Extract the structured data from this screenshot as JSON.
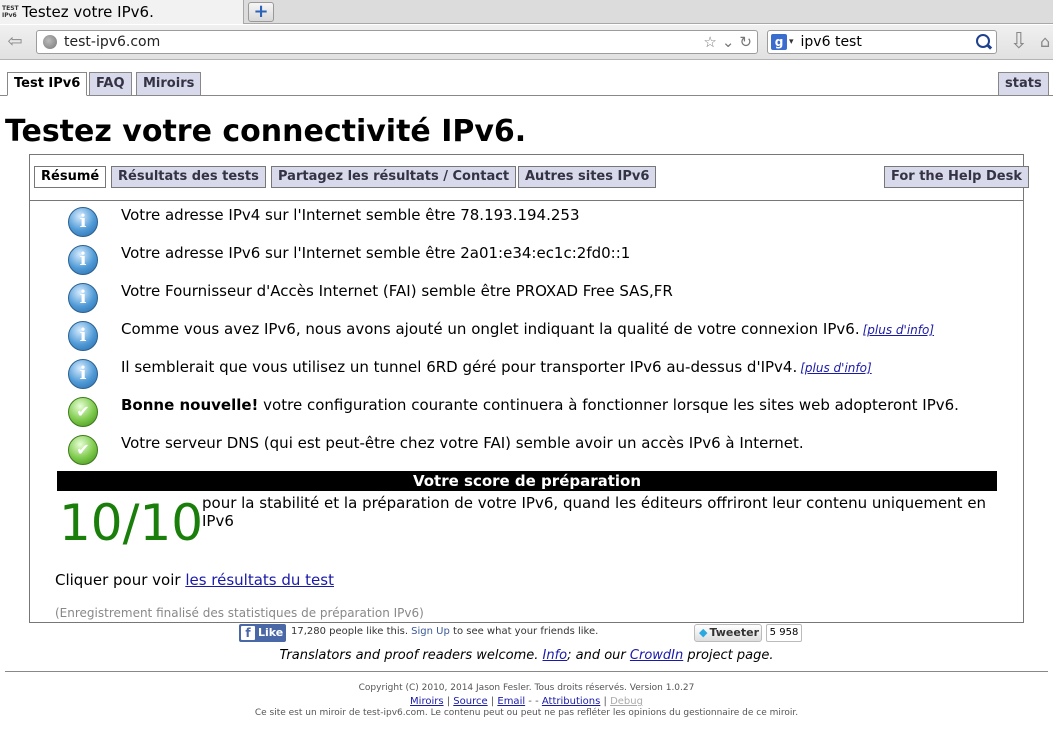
{
  "browser": {
    "tab_title": "Testez votre IPv6.",
    "favicon_text": "TEST IPv6",
    "new_tab": "+",
    "url": "test-ipv6.com",
    "search_query": "ipv6 test",
    "search_engine": "g"
  },
  "site_tabs": [
    "Test IPv6",
    "FAQ",
    "Miroirs"
  ],
  "stats_tab": "stats",
  "page_title": "Testez votre connectivité IPv6.",
  "panel_tabs": [
    "Résumé",
    "Résultats des tests",
    "Partagez les résultats / Contact",
    "Autres sites IPv6"
  ],
  "help_desk_tab": "For the Help Desk",
  "results": [
    {
      "icon": "info",
      "text": "Votre adresse IPv4 sur l'Internet semble être 78.193.194.253"
    },
    {
      "icon": "info",
      "text": "Votre adresse IPv6 sur l'Internet semble être 2a01:e34:ec1c:2fd0::1"
    },
    {
      "icon": "info",
      "text": "Votre Fournisseur d'Accès Internet (FAI) semble être PROXAD Free SAS,FR"
    },
    {
      "icon": "info",
      "text": "Comme vous avez IPv6, nous avons ajouté un onglet indiquant la qualité de votre connexion IPv6.",
      "more": "[plus d'info]"
    },
    {
      "icon": "info",
      "text": "Il semblerait que vous utilisez un tunnel 6RD géré pour transporter IPv6 au-dessus d'IPv4.",
      "more": "[plus d'info]"
    },
    {
      "icon": "ok",
      "bold": "Bonne nouvelle!",
      "text": " votre configuration courante continuera à fonctionner lorsque les sites web adopteront IPv6."
    },
    {
      "icon": "ok",
      "text": "Votre serveur DNS (qui est peut-être chez votre FAI) semble avoir un accès IPv6 à Internet."
    }
  ],
  "score": {
    "header": "Votre score de préparation",
    "value": "10/10",
    "description": "pour la stabilité et la préparation de votre IPv6, quand les éditeurs offriront leur contenu uniquement en IPv6"
  },
  "click_prefix": "Cliquer pour voir ",
  "click_link": "les résultats du test",
  "finalized": "(Enregistrement finalisé des statistiques de préparation IPv6)",
  "social": {
    "like": "Like",
    "like_text_pre": "17,280 people like this. ",
    "signup": "Sign Up",
    "like_text_post": " to see what your friends like.",
    "tweet": "Tweeter",
    "tweet_count": "5 958"
  },
  "translators": {
    "pre": "Translators and proof readers welcome. ",
    "info": "Info",
    "mid": "; and our ",
    "crowdin": "CrowdIn",
    "post": " project page."
  },
  "copyright": "Copyright (C) 2010, 2014 Jason Fesler. Tous droits réservés. Version 1.0.27",
  "footer_links": {
    "miroirs": "Miroirs",
    "sep1": " | ",
    "source": "Source",
    "sep2": " | ",
    "email": "Email",
    "sep3": " -  - ",
    "attributions": "Attributions",
    "sep4": " | ",
    "debug": "Debug"
  },
  "mirror_note": "Ce site est un miroir de test-ipv6.com. Le contenu peut ou peut ne pas refléter les opinions du gestionnaire de ce miroir."
}
